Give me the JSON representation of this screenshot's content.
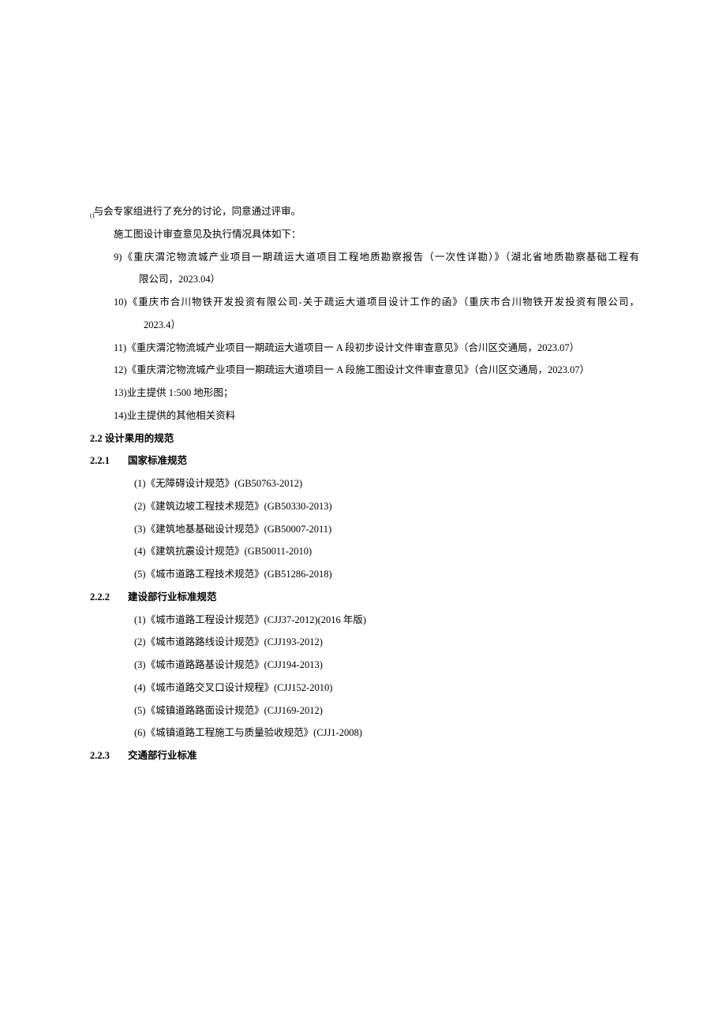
{
  "intro": {
    "sub": "(1",
    "text": "与会专家组进行了充分的讨论，同意通过评审。"
  },
  "exec_line": "施工图设计审查意见及执行情况具体如下：",
  "items_numbered": {
    "i9": {
      "line1": "9)《重庆渭沱物流城产业项目一期疏运大道项目工程地质勘察报告（一次性详勘）》（湖北省地质勘察基础工程有",
      "line2": "限公司，2023.04）"
    },
    "i10": {
      "line1": "10)《重庆市合川物铁开发投资有限公司-关于疏运大道项目设计工作的函》（重庆市合川物铁开发投资有限公司，",
      "line2": "2023.4）"
    },
    "i11": "11)《重庆渭沱物流城产业项目一期疏运大道项目一 A 段初步设计文件审查意见》（合川区交通局，2023.07）",
    "i12": "12)《重庆渭沱物流城产业项目一期疏运大道项目一 A 段施工图设计文件审查意见》（合川区交通局，2023.07）",
    "i13": "13)业主提供 1:500 地形图；",
    "i14": "14)业主提供的其他相关资料"
  },
  "sec22": "2.2 设计果用的规范",
  "sec221": {
    "num": "2.2.1",
    "title": "国家标准规范"
  },
  "list221": {
    "a": "(1)《无障碍设计规范》(GB50763-2012)",
    "b": "(2)《建筑边坡工程技术规范》(GB50330-2013)",
    "c": "(3)《建筑地基基础设计规范》(GB50007-2011)",
    "d": "(4)《建筑抗震设计规范》(GB50011-2010)",
    "e": "(5)《城市道路工程技术规范》(GB51286-2018)"
  },
  "sec222": {
    "num": "2.2.2",
    "title": "建设部行业标准规范"
  },
  "list222": {
    "a": "(1)《城市道路工程设计规范》(CJJ37-2012)(2016 年版)",
    "b": "(2)《城市道路路线设计规范》(CJJ193-2012)",
    "c": "(3)《城市道路路基设计规范》(CJJ194-2013)",
    "d": "(4)《城市道路交叉口设计规程》(CJJ152-2010)",
    "e": "(5)《城镇道路路面设计规范》(CJJ169-2012)",
    "f": "(6)《城镇道路工程施工与质量验收规范》(CJJ1-2008)"
  },
  "sec223": {
    "num": "2.2.3",
    "title": "交通部行业标准"
  }
}
